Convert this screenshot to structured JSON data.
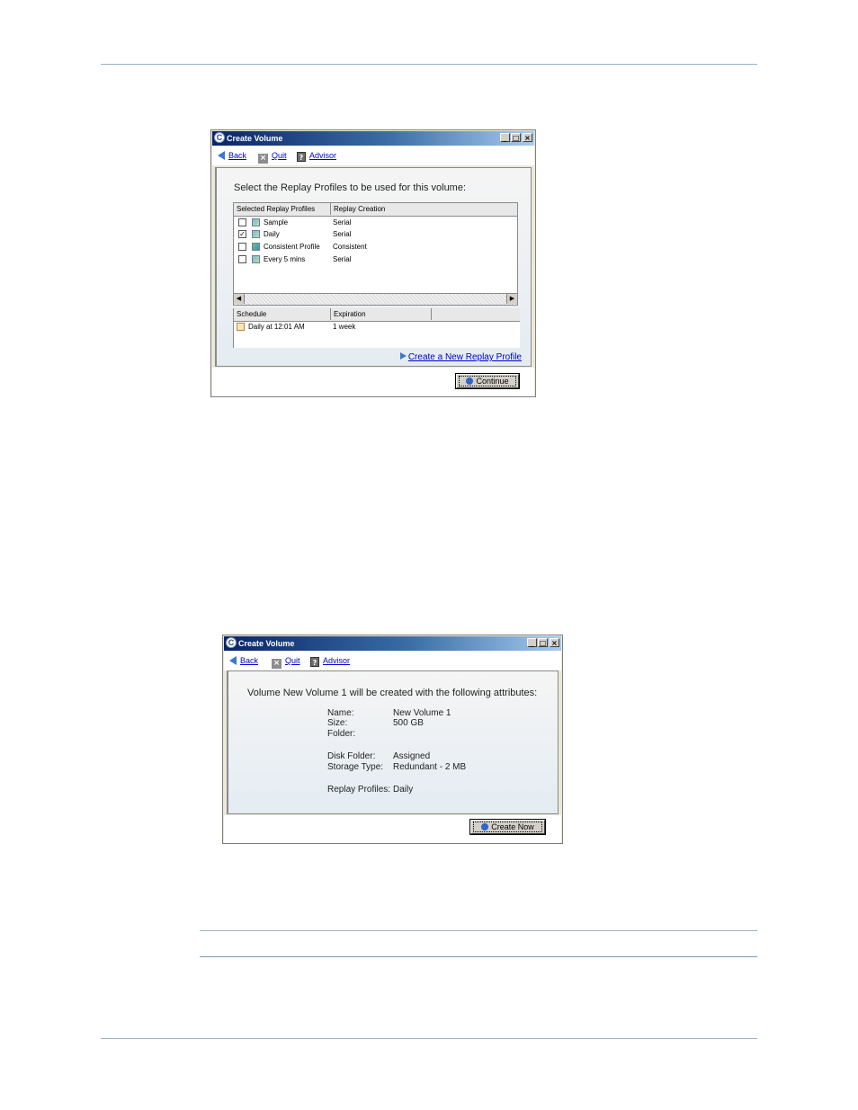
{
  "window1": {
    "title": "Create Volume",
    "toolbar": {
      "back": "Back",
      "quit": "Quit",
      "advisor": "Advisor"
    },
    "heading": "Select the Replay Profiles to be used for this volume:",
    "profiles_table": {
      "columns": [
        "Selected Replay Profiles",
        "Replay Creation"
      ],
      "rows": [
        {
          "checked": false,
          "name": "Sample",
          "creation": "Serial"
        },
        {
          "checked": true,
          "name": "Daily",
          "creation": "Serial"
        },
        {
          "checked": false,
          "name": "Consistent Profile",
          "creation": "Consistent"
        },
        {
          "checked": false,
          "name": "Every 5 mins",
          "creation": "Serial"
        }
      ]
    },
    "schedule_table": {
      "columns": [
        "Schedule",
        "Expiration"
      ],
      "rows": [
        {
          "schedule": "Daily at 12:01 AM",
          "expiration": "1 week"
        }
      ]
    },
    "create_link": "Create a New Replay Profile",
    "continue_button": "Continue"
  },
  "window2": {
    "title": "Create Volume",
    "toolbar": {
      "back": "Back",
      "quit": "Quit",
      "advisor": "Advisor"
    },
    "heading": "Volume New Volume 1 will be created with the following attributes:",
    "attributes": [
      {
        "label": "Name:",
        "value": "New Volume 1"
      },
      {
        "label": "Size:",
        "value": "500 GB"
      },
      {
        "label": "Folder:",
        "value": ""
      },
      {
        "label": "Disk Folder:",
        "value": "Assigned"
      },
      {
        "label": "Storage Type:",
        "value": "Redundant - 2 MB"
      },
      {
        "label": "Replay Profiles:",
        "value": "Daily"
      }
    ],
    "create_button": "Create Now"
  }
}
